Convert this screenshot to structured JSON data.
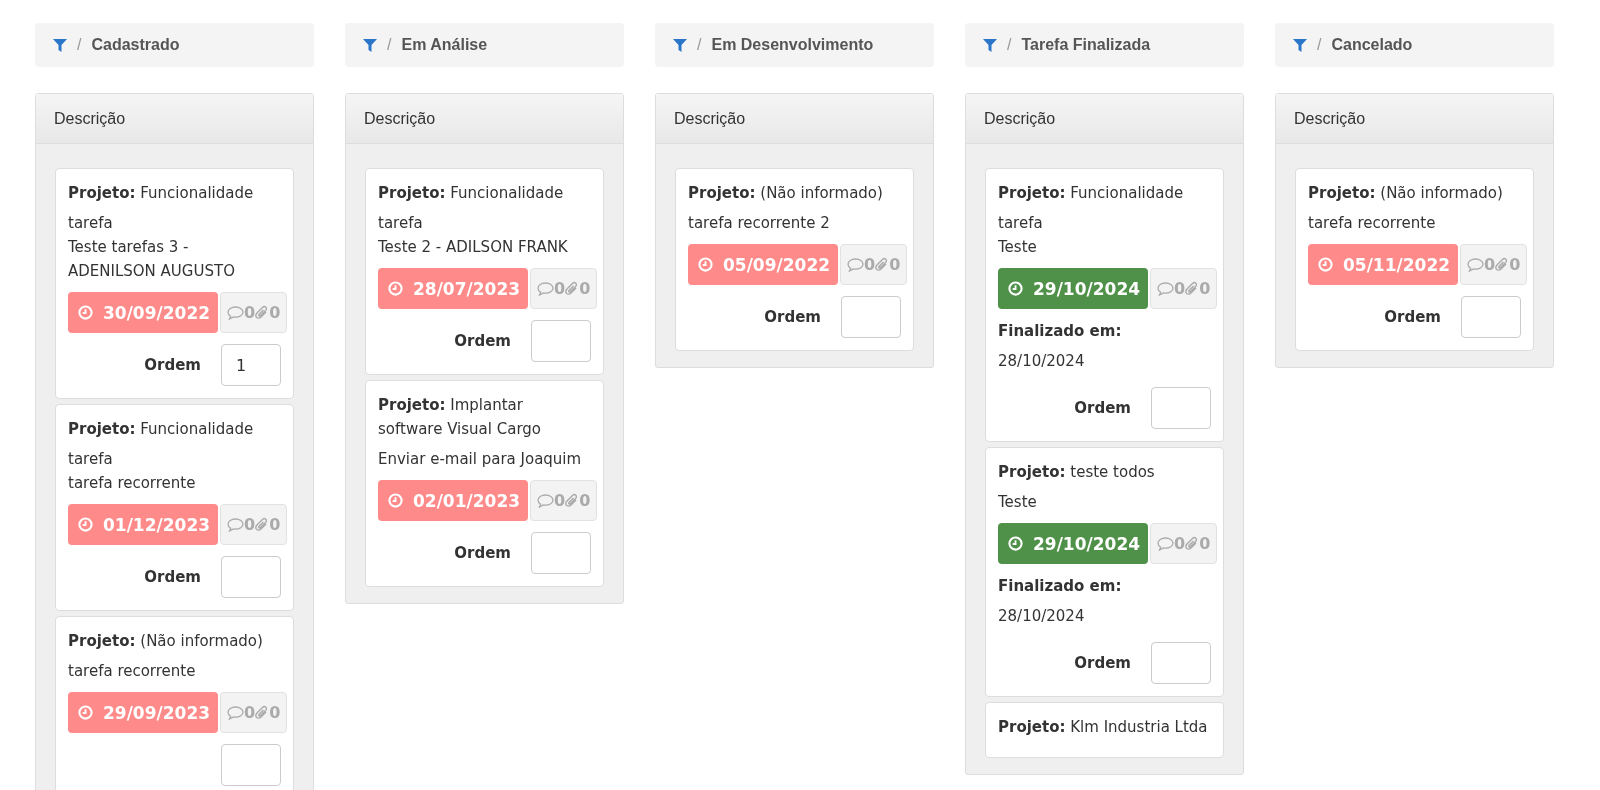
{
  "columns": [
    {
      "separator": "/",
      "title": "Cadastrado",
      "panel_header": "Descrição",
      "cards": [
        {
          "project_label": "Projeto:",
          "project": "Funcionalidade",
          "title_lines": [
            "tarefa",
            "Teste tarefas 3 - ADENILSON AUGUSTO"
          ],
          "due": {
            "date": "30/09/2022",
            "color": "#ff8a8a"
          },
          "comments": "0",
          "attachments": "0",
          "order_field": true,
          "order_label": "Ordem",
          "order_value": "1"
        },
        {
          "project_label": "Projeto:",
          "project": "Funcionalidade",
          "title_lines": [
            "tarefa",
            "tarefa recorrente"
          ],
          "due": {
            "date": "01/12/2023",
            "color": "#ff8a8a"
          },
          "comments": "0",
          "attachments": "0",
          "order_field": true,
          "order_label": "Ordem"
        },
        {
          "project_label": "Projeto:",
          "project": "(Não informado)",
          "title_lines": [
            "tarefa recorrente"
          ],
          "due": {
            "date": "29/09/2023",
            "color": "#ff8a8a"
          },
          "comments": "0",
          "attachments": "0",
          "order_field": true
        }
      ]
    },
    {
      "separator": "/",
      "title": "Em Análise",
      "panel_header": "Descrição",
      "cards": [
        {
          "project_label": "Projeto:",
          "project": "Funcionalidade",
          "title_lines": [
            "tarefa",
            "Teste 2 - ADILSON FRANK"
          ],
          "due": {
            "date": "28/07/2023",
            "color": "#ff8a8a"
          },
          "comments": "0",
          "attachments": "0",
          "order_field": true,
          "order_label": "Ordem"
        },
        {
          "project_label": "Projeto:",
          "project": "Implantar software Visual Cargo",
          "title_lines": [
            "Enviar e-mail para Joaquim"
          ],
          "due": {
            "date": "02/01/2023",
            "color": "#ff8a8a"
          },
          "comments": "0",
          "attachments": "0",
          "order_field": true,
          "order_label": "Ordem"
        }
      ]
    },
    {
      "separator": "/",
      "title": "Em Desenvolvimento",
      "panel_header": "Descrição",
      "cards": [
        {
          "project_label": "Projeto:",
          "project": "(Não informado)",
          "title_lines": [
            "tarefa recorrente 2"
          ],
          "due": {
            "date": "05/09/2022",
            "color": "#ff8a8a"
          },
          "comments": "0",
          "attachments": "0",
          "order_field": true,
          "order_label": "Ordem"
        }
      ]
    },
    {
      "separator": "/",
      "title": "Tarefa Finalizada",
      "panel_header": "Descrição",
      "cards": [
        {
          "project_label": "Projeto:",
          "project": "Funcionalidade",
          "title_lines": [
            "tarefa",
            "Teste"
          ],
          "due": {
            "date": "29/10/2024",
            "color": "#4f9148"
          },
          "comments": "0",
          "attachments": "0",
          "finished_label": "Finalizado em:",
          "finished_date": "28/10/2024",
          "order_field": true,
          "order_label": "Ordem"
        },
        {
          "project_label": "Projeto:",
          "project": "teste todos",
          "title_lines": [
            "Teste"
          ],
          "due": {
            "date": "29/10/2024",
            "color": "#4f9148"
          },
          "comments": "0",
          "attachments": "0",
          "finished_label": "Finalizado em:",
          "finished_date": "28/10/2024",
          "order_field": true,
          "order_label": "Ordem"
        },
        {
          "project_label": "Projeto:",
          "project": "Klm Industria Ltda",
          "order_field": false
        }
      ]
    },
    {
      "separator": "/",
      "title": "Cancelado",
      "panel_header": "Descrição",
      "cards": [
        {
          "project_label": "Projeto:",
          "project": "(Não informado)",
          "title_lines": [
            "tarefa recorrente"
          ],
          "due": {
            "date": "05/11/2022",
            "color": "#ff8a8a"
          },
          "comments": "0",
          "attachments": "0",
          "order_field": true,
          "order_label": "Ordem"
        }
      ]
    }
  ]
}
